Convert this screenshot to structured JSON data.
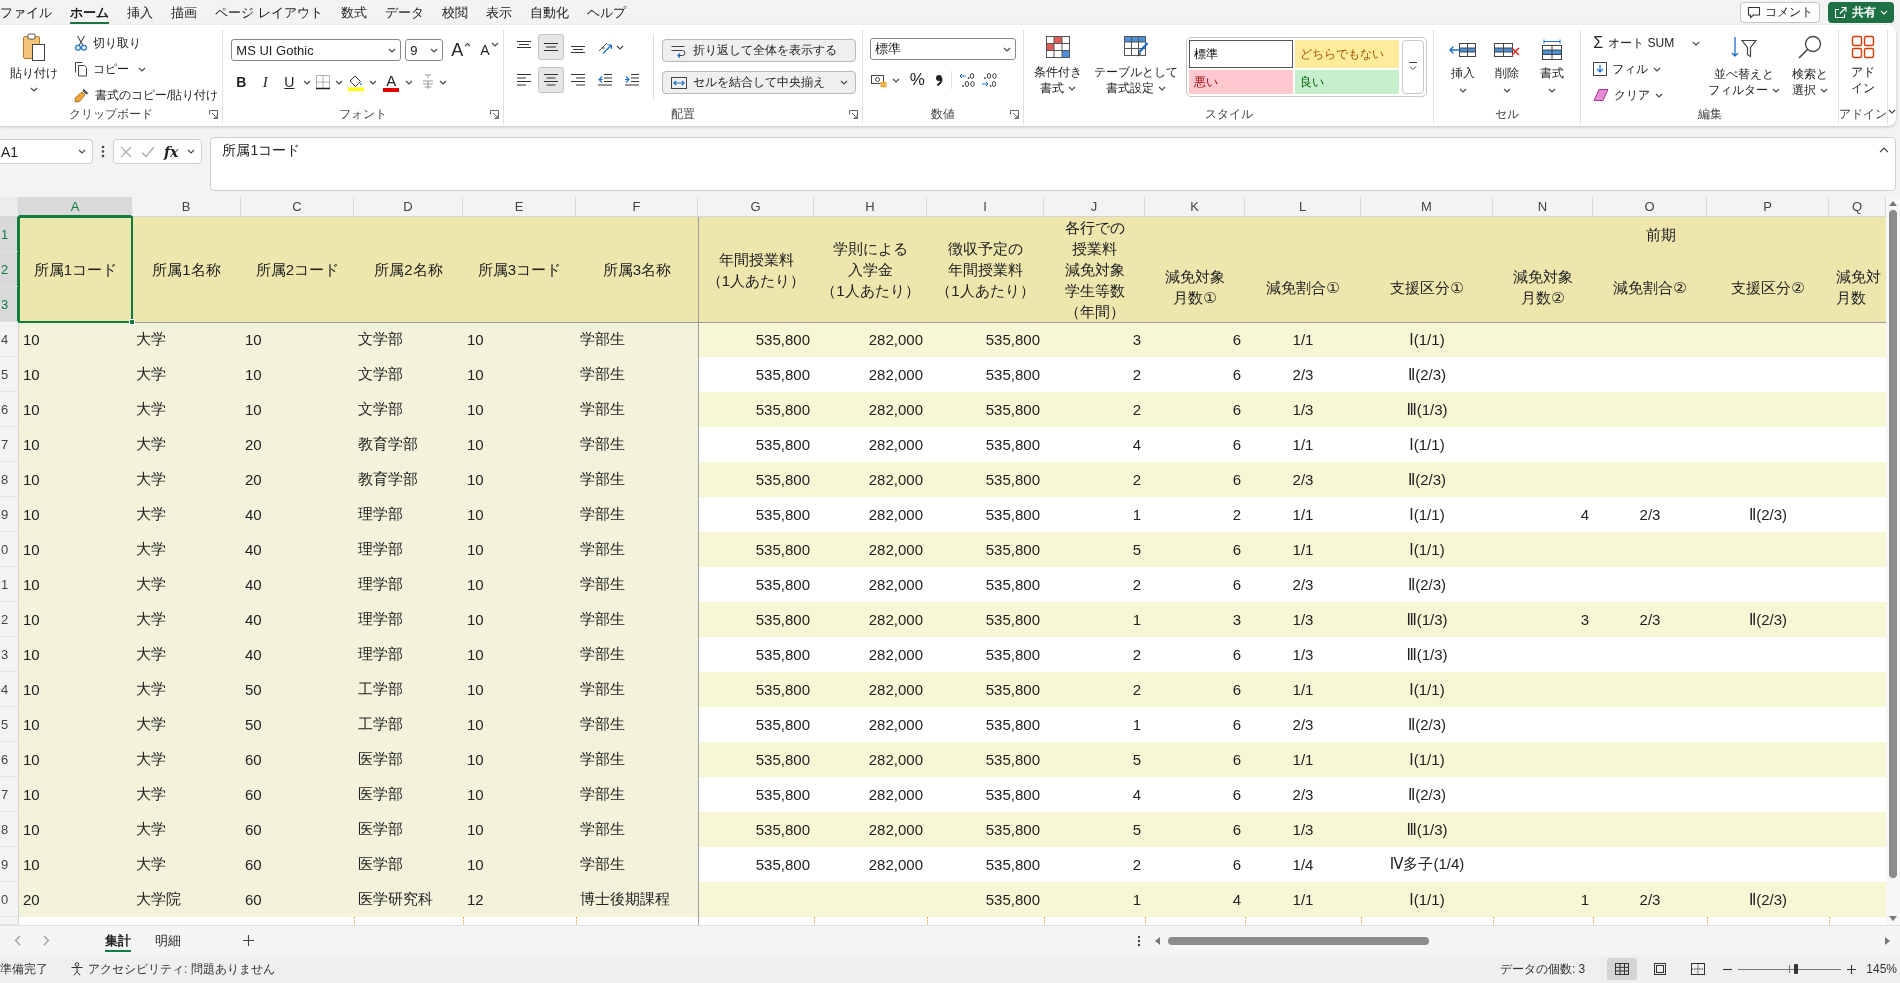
{
  "menu": {
    "tabs": [
      {
        "label": "ファイル",
        "selected": false
      },
      {
        "label": "ホーム",
        "selected": true
      },
      {
        "label": "挿入",
        "selected": false
      },
      {
        "label": "描画",
        "selected": false
      },
      {
        "label": "ページ レイアウト",
        "selected": false
      },
      {
        "label": "数式",
        "selected": false
      },
      {
        "label": "データ",
        "selected": false
      },
      {
        "label": "校閲",
        "selected": false
      },
      {
        "label": "表示",
        "selected": false
      },
      {
        "label": "自動化",
        "selected": false
      },
      {
        "label": "ヘルプ",
        "selected": false
      }
    ],
    "buttons": [
      {
        "kind": "comment",
        "label": "コメント"
      },
      {
        "kind": "share",
        "label": "共有"
      }
    ]
  },
  "ribbon": {
    "clipboard": {
      "label": "クリップボード",
      "paste": "貼り付け",
      "cut": "切り取り",
      "copy": "コピー",
      "format_painter": "書式のコピー/貼り付け"
    },
    "font": {
      "label": "フォント",
      "font_name": "MS UI Gothic",
      "font_size": "9",
      "grow": "A",
      "shrink": "A",
      "bold": "B",
      "italic": "I",
      "underline": "U",
      "font_color": "A"
    },
    "alignment": {
      "label": "配置",
      "vertical": [
        {
          "kind": "top",
          "selected": false
        },
        {
          "kind": "middle",
          "selected": true
        },
        {
          "kind": "bottom",
          "selected": false
        }
      ],
      "horizontal": [
        {
          "kind": "left",
          "selected": false
        },
        {
          "kind": "center",
          "selected": true
        },
        {
          "kind": "right",
          "selected": false
        }
      ],
      "wrap_text": {
        "label": "折り返して全体を表示する",
        "on": true
      },
      "merge_center": {
        "label": "セルを結合して中央揃え",
        "on": true
      }
    },
    "number": {
      "label": "数値",
      "format": "標準",
      "percent": "%"
    },
    "styles": {
      "label": "スタイル",
      "conditional": "条件付き書式",
      "as_table": "テーブルとして書式設定",
      "gallery": [
        {
          "kind": "normal",
          "label": "標準",
          "selected": true
        },
        {
          "kind": "neutral",
          "label": "どちらでもない",
          "selected": false
        },
        {
          "kind": "bad",
          "label": "悪い",
          "selected": false
        },
        {
          "kind": "good",
          "label": "良い",
          "selected": false
        }
      ]
    },
    "cells": {
      "label": "セル",
      "buttons": [
        {
          "kind": "insert",
          "label": "挿入"
        },
        {
          "kind": "delete",
          "label": "削除"
        },
        {
          "kind": "format",
          "label": "書式"
        }
      ]
    },
    "editing": {
      "label": "編集",
      "sigma": "Σ",
      "autosum": "オート SUM",
      "fill": "フィル",
      "clear": "クリア",
      "sort": "並べ替えとフィルター",
      "find": "検索と選択"
    },
    "addins": {
      "label": "アドイン",
      "button": "アドイン"
    }
  },
  "formula_bar": {
    "name_box": "A1",
    "function_symbol": "fx",
    "formula": "所属1コード"
  },
  "sheet": {
    "columns": [
      {
        "letter": "A",
        "selected": true
      },
      {
        "letter": "B",
        "selected": false
      },
      {
        "letter": "C",
        "selected": false
      },
      {
        "letter": "D",
        "selected": false
      },
      {
        "letter": "E",
        "selected": false
      },
      {
        "letter": "F",
        "selected": false
      },
      {
        "letter": "G",
        "selected": false
      },
      {
        "letter": "H",
        "selected": false
      },
      {
        "letter": "I",
        "selected": false
      },
      {
        "letter": "J",
        "selected": false
      },
      {
        "letter": "K",
        "selected": false
      },
      {
        "letter": "L",
        "selected": false
      },
      {
        "letter": "M",
        "selected": false
      },
      {
        "letter": "N",
        "selected": false
      },
      {
        "letter": "O",
        "selected": false
      },
      {
        "letter": "P",
        "selected": false
      },
      {
        "letter": "Q",
        "selected": false
      }
    ],
    "header_rows": [
      {
        "number": "1",
        "selected": true
      },
      {
        "number": "2",
        "selected": true
      },
      {
        "number": "3",
        "selected": true
      }
    ],
    "header": [
      {
        "kind": "full",
        "text": "所属1コード"
      },
      {
        "kind": "full",
        "text": "所属1名称"
      },
      {
        "kind": "full",
        "text": "所属2コード"
      },
      {
        "kind": "full",
        "text": "所属2名称"
      },
      {
        "kind": "full",
        "text": "所属3コード"
      },
      {
        "kind": "full",
        "text": "所属3名称"
      },
      {
        "kind": "full",
        "text": "年間授業料（1人あたり）"
      },
      {
        "kind": "full",
        "text": "学則による入学金（1人あたり）"
      },
      {
        "kind": "full",
        "text": "徴収予定の年間授業料（1人あたり）"
      },
      {
        "kind": "full",
        "text": "各行での授業料減免対象学生等数（年間）"
      },
      {
        "kind": "lower",
        "text": "減免対象月数①"
      },
      {
        "kind": "lower",
        "text": "減免割合①"
      },
      {
        "kind": "lower",
        "text": "支援区分①"
      },
      {
        "kind": "group",
        "label": "前期",
        "children": [
          {
            "text": "減免対象月数②"
          },
          {
            "text": "減免割合②"
          },
          {
            "text": "支援区分②"
          }
        ]
      },
      {
        "kind": "lower",
        "text": "減免対月数"
      }
    ],
    "rows": [
      {
        "number": "4",
        "selected": false,
        "cells": {
          "A": "10",
          "B": "大学",
          "C": "10",
          "D": "文学部",
          "E": "10",
          "F": "学部生",
          "G": "535,800",
          "H": "282,000",
          "I": "535,800",
          "J": "3",
          "K": "6",
          "L": "1/1",
          "M": "Ⅰ(1/1)"
        }
      },
      {
        "number": "5",
        "selected": false,
        "cells": {
          "A": "10",
          "B": "大学",
          "C": "10",
          "D": "文学部",
          "E": "10",
          "F": "学部生",
          "G": "535,800",
          "H": "282,000",
          "I": "535,800",
          "J": "2",
          "K": "6",
          "L": "2/3",
          "M": "Ⅱ(2/3)"
        }
      },
      {
        "number": "6",
        "selected": false,
        "cells": {
          "A": "10",
          "B": "大学",
          "C": "10",
          "D": "文学部",
          "E": "10",
          "F": "学部生",
          "G": "535,800",
          "H": "282,000",
          "I": "535,800",
          "J": "2",
          "K": "6",
          "L": "1/3",
          "M": "Ⅲ(1/3)"
        }
      },
      {
        "number": "7",
        "selected": false,
        "cells": {
          "A": "10",
          "B": "大学",
          "C": "20",
          "D": "教育学部",
          "E": "10",
          "F": "学部生",
          "G": "535,800",
          "H": "282,000",
          "I": "535,800",
          "J": "4",
          "K": "6",
          "L": "1/1",
          "M": "Ⅰ(1/1)"
        }
      },
      {
        "number": "8",
        "selected": false,
        "cells": {
          "A": "10",
          "B": "大学",
          "C": "20",
          "D": "教育学部",
          "E": "10",
          "F": "学部生",
          "G": "535,800",
          "H": "282,000",
          "I": "535,800",
          "J": "2",
          "K": "6",
          "L": "2/3",
          "M": "Ⅱ(2/3)"
        }
      },
      {
        "number": "9",
        "selected": false,
        "cells": {
          "A": "10",
          "B": "大学",
          "C": "40",
          "D": "理学部",
          "E": "10",
          "F": "学部生",
          "G": "535,800",
          "H": "282,000",
          "I": "535,800",
          "J": "1",
          "K": "2",
          "L": "1/1",
          "M": "Ⅰ(1/1)",
          "N": "4",
          "O": "2/3",
          "P": "Ⅱ(2/3)"
        }
      },
      {
        "number": "0",
        "selected": false,
        "cells": {
          "A": "10",
          "B": "大学",
          "C": "40",
          "D": "理学部",
          "E": "10",
          "F": "学部生",
          "G": "535,800",
          "H": "282,000",
          "I": "535,800",
          "J": "5",
          "K": "6",
          "L": "1/1",
          "M": "Ⅰ(1/1)"
        }
      },
      {
        "number": "1",
        "selected": false,
        "cells": {
          "A": "10",
          "B": "大学",
          "C": "40",
          "D": "理学部",
          "E": "10",
          "F": "学部生",
          "G": "535,800",
          "H": "282,000",
          "I": "535,800",
          "J": "2",
          "K": "6",
          "L": "2/3",
          "M": "Ⅱ(2/3)"
        }
      },
      {
        "number": "2",
        "selected": false,
        "cells": {
          "A": "10",
          "B": "大学",
          "C": "40",
          "D": "理学部",
          "E": "10",
          "F": "学部生",
          "G": "535,800",
          "H": "282,000",
          "I": "535,800",
          "J": "1",
          "K": "3",
          "L": "1/3",
          "M": "Ⅲ(1/3)",
          "N": "3",
          "O": "2/3",
          "P": "Ⅱ(2/3)"
        }
      },
      {
        "number": "3",
        "selected": false,
        "cells": {
          "A": "10",
          "B": "大学",
          "C": "40",
          "D": "理学部",
          "E": "10",
          "F": "学部生",
          "G": "535,800",
          "H": "282,000",
          "I": "535,800",
          "J": "2",
          "K": "6",
          "L": "1/3",
          "M": "Ⅲ(1/3)"
        }
      },
      {
        "number": "4",
        "selected": false,
        "cells": {
          "A": "10",
          "B": "大学",
          "C": "50",
          "D": "工学部",
          "E": "10",
          "F": "学部生",
          "G": "535,800",
          "H": "282,000",
          "I": "535,800",
          "J": "2",
          "K": "6",
          "L": "1/1",
          "M": "Ⅰ(1/1)"
        }
      },
      {
        "number": "5",
        "selected": false,
        "cells": {
          "A": "10",
          "B": "大学",
          "C": "50",
          "D": "工学部",
          "E": "10",
          "F": "学部生",
          "G": "535,800",
          "H": "282,000",
          "I": "535,800",
          "J": "1",
          "K": "6",
          "L": "2/3",
          "M": "Ⅱ(2/3)"
        }
      },
      {
        "number": "6",
        "selected": false,
        "cells": {
          "A": "10",
          "B": "大学",
          "C": "60",
          "D": "医学部",
          "E": "10",
          "F": "学部生",
          "G": "535,800",
          "H": "282,000",
          "I": "535,800",
          "J": "5",
          "K": "6",
          "L": "1/1",
          "M": "Ⅰ(1/1)"
        }
      },
      {
        "number": "7",
        "selected": false,
        "cells": {
          "A": "10",
          "B": "大学",
          "C": "60",
          "D": "医学部",
          "E": "10",
          "F": "学部生",
          "G": "535,800",
          "H": "282,000",
          "I": "535,800",
          "J": "4",
          "K": "6",
          "L": "2/3",
          "M": "Ⅱ(2/3)"
        }
      },
      {
        "number": "8",
        "selected": false,
        "cells": {
          "A": "10",
          "B": "大学",
          "C": "60",
          "D": "医学部",
          "E": "10",
          "F": "学部生",
          "G": "535,800",
          "H": "282,000",
          "I": "535,800",
          "J": "5",
          "K": "6",
          "L": "1/3",
          "M": "Ⅲ(1/3)"
        }
      },
      {
        "number": "9",
        "selected": false,
        "cells": {
          "A": "10",
          "B": "大学",
          "C": "60",
          "D": "医学部",
          "E": "10",
          "F": "学部生",
          "G": "535,800",
          "H": "282,000",
          "I": "535,800",
          "J": "2",
          "K": "6",
          "L": "1/4",
          "M": "Ⅳ多子(1/4)"
        }
      },
      {
        "number": "0",
        "selected": false,
        "cells": {
          "A": "20",
          "B": "大学院",
          "C": "60",
          "D": "医学研究科",
          "E": "12",
          "F": "博士後期課程",
          "I": "535,800",
          "J": "1",
          "K": "4",
          "L": "1/1",
          "M": "Ⅰ(1/1)",
          "N": "1",
          "O": "2/3",
          "P": "Ⅱ(2/3)"
        }
      }
    ]
  },
  "sheet_tabs": [
    {
      "label": "集計",
      "selected": true
    },
    {
      "label": "明細",
      "selected": false
    }
  ],
  "status_bar": {
    "status": "準備完了",
    "accessibility": "アクセシビリティ: 問題ありません",
    "count": "データの個数: 3",
    "views": [
      {
        "kind": "normal",
        "selected": true
      },
      {
        "kind": "page_layout",
        "selected": false
      },
      {
        "kind": "page_break",
        "selected": false
      }
    ],
    "zoom": {
      "level": 0.56,
      "label": "145%"
    }
  }
}
